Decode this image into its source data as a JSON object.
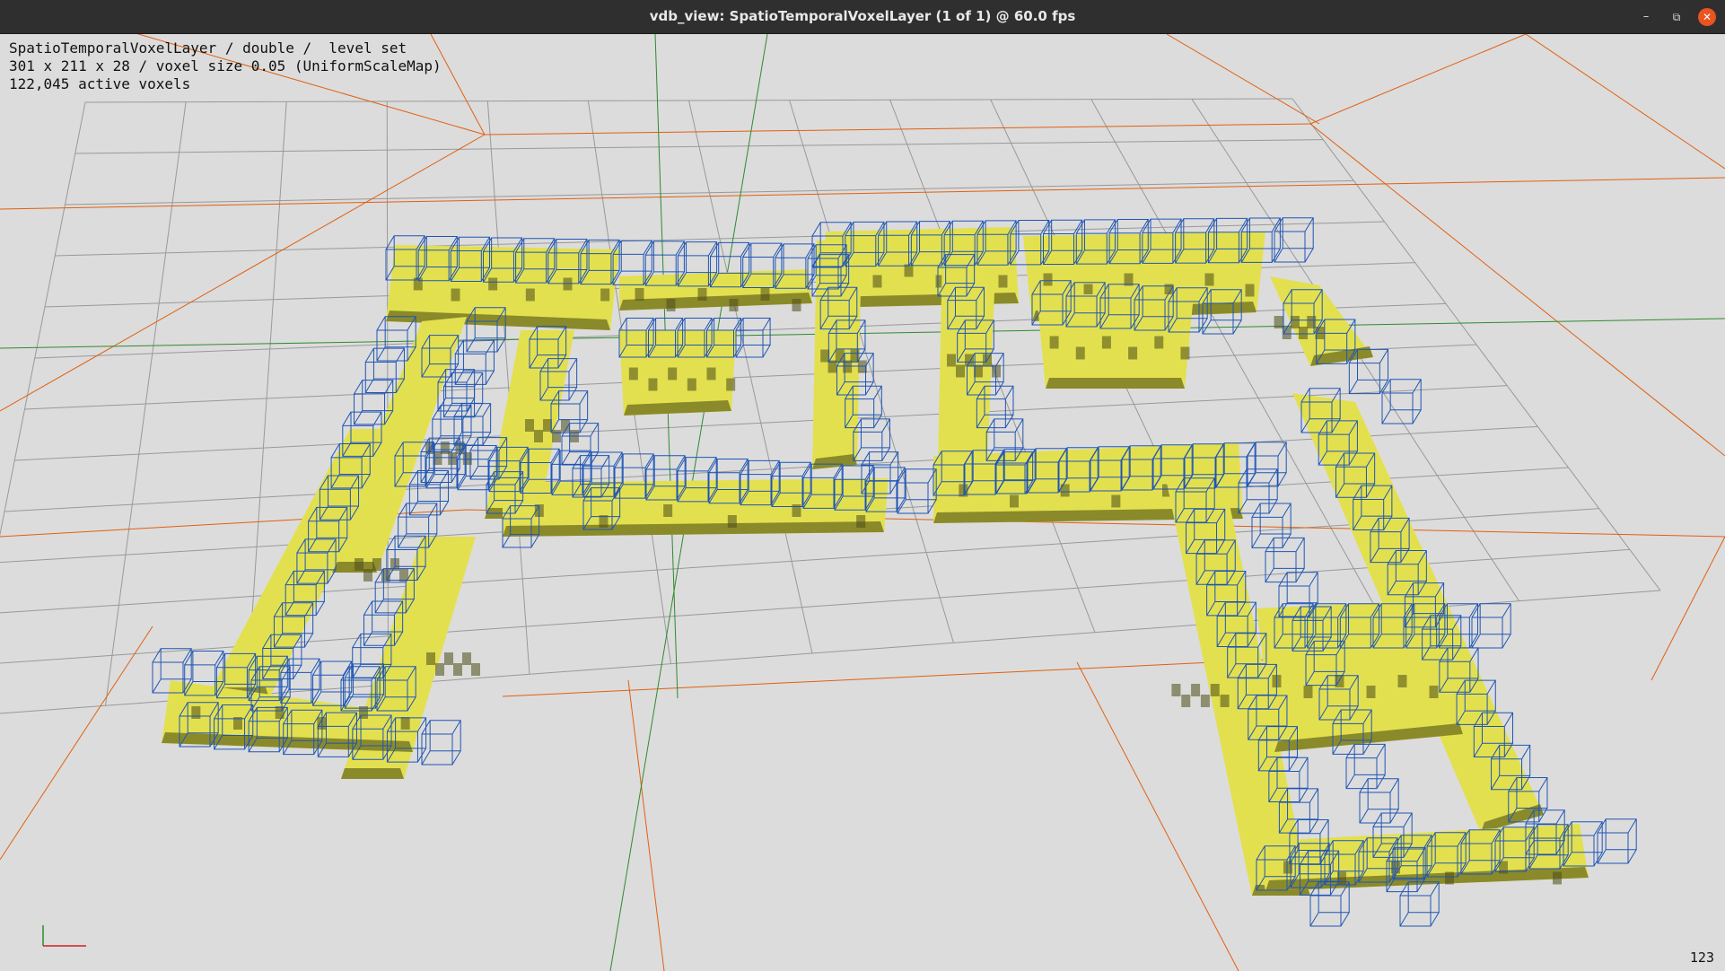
{
  "window": {
    "title": "vdb_view: SpatioTemporalVoxelLayer (1 of 1) @ 60.0 fps",
    "minimize_icon": "minimize-icon",
    "maximize_icon": "restore-icon",
    "close_icon": "close-icon"
  },
  "info": {
    "line1": "SpatioTemporalVoxelLayer / double /  level set",
    "line2": "301 x 211 x 28 / voxel size 0.05 (UniformScaleMap)",
    "line3": "122,045 active voxels"
  },
  "frame_counter": "123",
  "colors": {
    "background": "#dcdcdc",
    "voxel_fill": "#e3e04f",
    "voxel_shade": "#8a8a2a",
    "voxel_dark": "#4d4d18",
    "leaf_bbox": "#1f55b5",
    "grid": "#999999",
    "bounds": "#e06010",
    "axis_x": "#d02020",
    "axis_y": "#2f8a2f"
  }
}
